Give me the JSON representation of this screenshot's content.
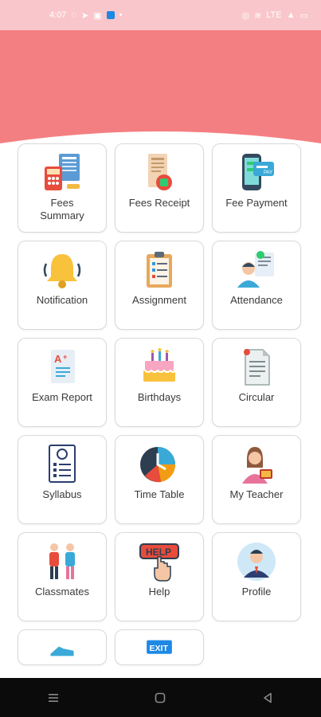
{
  "status_bar": {
    "time": "4:07",
    "signal": "LTE"
  },
  "colors": {
    "header": "#f47f82",
    "status_bar": "#f9c7cb",
    "tile_border": "#d9d9d9",
    "nav_bar": "#0b0b0b"
  },
  "menu": {
    "items": [
      {
        "label": "Fees\nSummary",
        "icon": "calculator-invoice-icon"
      },
      {
        "label": "Fees Receipt",
        "icon": "receipt-icon"
      },
      {
        "label": "Fee Payment",
        "icon": "phone-payment-icon"
      },
      {
        "label": "Notification",
        "icon": "bell-icon"
      },
      {
        "label": "Assignment",
        "icon": "clipboard-icon"
      },
      {
        "label": "Attendance",
        "icon": "attendance-icon"
      },
      {
        "label": "Exam Report",
        "icon": "exam-report-icon"
      },
      {
        "label": "Birthdays",
        "icon": "cake-icon"
      },
      {
        "label": "Circular",
        "icon": "circular-document-icon"
      },
      {
        "label": "Syllabus",
        "icon": "syllabus-icon"
      },
      {
        "label": "Time Table",
        "icon": "timetable-clock-icon"
      },
      {
        "label": "My Teacher",
        "icon": "teacher-icon"
      },
      {
        "label": "Classmates",
        "icon": "classmates-icon"
      },
      {
        "label": "Help",
        "icon": "help-hand-icon"
      },
      {
        "label": "Profile",
        "icon": "profile-avatar-icon"
      }
    ],
    "partial_items": [
      {
        "icon": "shoe-icon"
      },
      {
        "icon": "exit-sign-icon",
        "text": "EXIT"
      }
    ]
  },
  "nav_bar": {
    "recents": "recents-icon",
    "home": "home-icon",
    "back": "back-icon"
  }
}
